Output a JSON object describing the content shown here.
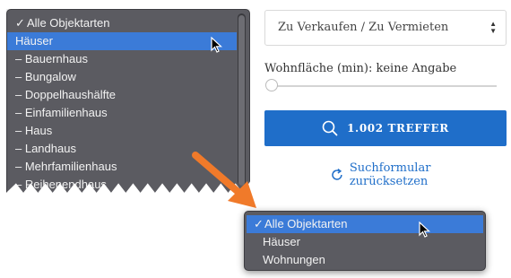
{
  "menu_top": {
    "items": [
      {
        "label": "Alle Objektarten",
        "checked": true,
        "selected": false
      },
      {
        "label": "Häuser",
        "checked": false,
        "selected": true
      },
      {
        "label": "– Bauernhaus",
        "checked": false,
        "selected": false
      },
      {
        "label": "– Bungalow",
        "checked": false,
        "selected": false
      },
      {
        "label": "– Doppelhaushälfte",
        "checked": false,
        "selected": false
      },
      {
        "label": "– Einfamilienhaus",
        "checked": false,
        "selected": false
      },
      {
        "label": "– Haus",
        "checked": false,
        "selected": false
      },
      {
        "label": "– Landhaus",
        "checked": false,
        "selected": false
      },
      {
        "label": "– Mehrfamilienhaus",
        "checked": false,
        "selected": false
      },
      {
        "label": "– Reihenendhaus",
        "checked": false,
        "selected": false
      }
    ],
    "check_mark": "✓"
  },
  "form": {
    "select_value": "Zu Verkaufen / Zu Vermieten",
    "area_label": "Wohnfläche (min): keine Angabe",
    "results_button": "1.002 TREFFER",
    "reset_link": "Suchformular zurücksetzen"
  },
  "menu_bottom": {
    "items": [
      {
        "label": "Alle Objektarten",
        "checked": true,
        "selected": true
      },
      {
        "label": "Häuser",
        "checked": false,
        "selected": false
      },
      {
        "label": "Wohnungen",
        "checked": false,
        "selected": false
      }
    ],
    "check_mark": "✓"
  },
  "colors": {
    "accent": "#1f6ec9",
    "menu_bg": "#5b5b61",
    "highlight": "#3b7bd8",
    "arrow": "#f07a2a"
  }
}
